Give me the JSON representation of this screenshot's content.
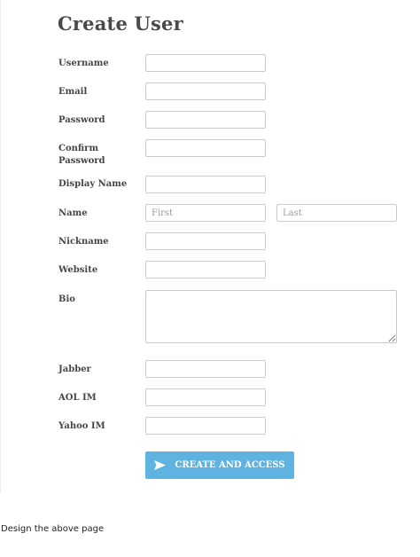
{
  "form": {
    "title": "Create User",
    "fields": {
      "username": {
        "label": "Username",
        "value": ""
      },
      "email": {
        "label": "Email",
        "value": ""
      },
      "password": {
        "label": "Password",
        "value": ""
      },
      "confirm_password": {
        "label_line1": "Confirm",
        "label_line2": "Password",
        "value": ""
      },
      "display_name": {
        "label": "Display Name",
        "value": ""
      },
      "name": {
        "label": "Name",
        "first_placeholder": "First",
        "last_placeholder": "Last"
      },
      "nickname": {
        "label": "Nickname",
        "value": ""
      },
      "website": {
        "label": "Website",
        "value": ""
      },
      "bio": {
        "label": "Bio",
        "value": ""
      },
      "jabber": {
        "label": "Jabber",
        "value": ""
      },
      "aol_im": {
        "label": "AOL IM",
        "value": ""
      },
      "yahoo_im": {
        "label": "Yahoo IM",
        "value": ""
      }
    },
    "submit": {
      "label": "CREATE AND ACCESS",
      "icon": "send-icon"
    }
  },
  "caption": "Design the above page",
  "colors": {
    "submit_bg": "#5fb3e0",
    "input_border": "#c9c9c9",
    "label_text": "#454545"
  }
}
